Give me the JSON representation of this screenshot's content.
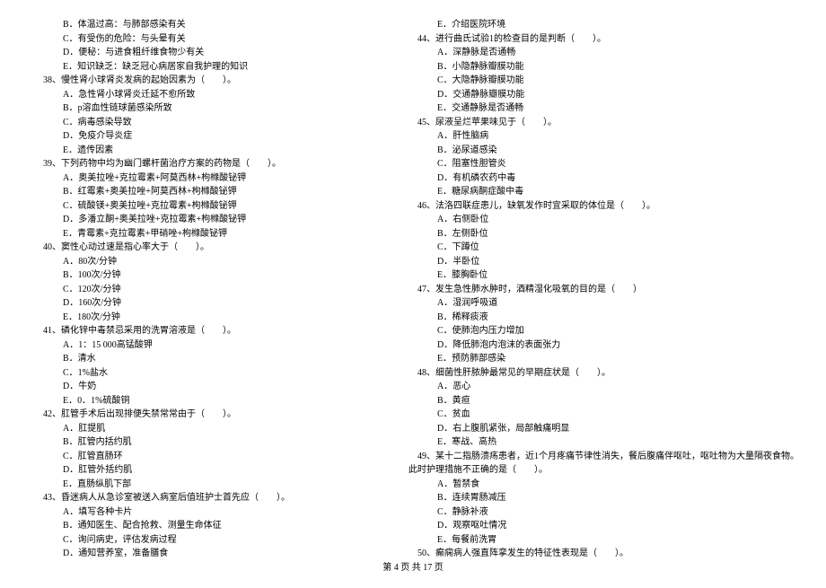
{
  "left_column": {
    "q37_options": [
      "B．体温过高：与肺部感染有关",
      "C．有受伤的危险：与头晕有关",
      "D．便秘：与进食粗纤维食物少有关",
      "E．知识缺乏：缺乏冠心病居家自我护理的知识"
    ],
    "q38": {
      "stem": "38、慢性肾小球肾炎发病的起始因素为（　　）。",
      "options": [
        "A．急性肾小球肾炎迁延不愈所致",
        "B．p溶血性链球菌感染所致",
        "C．病毒感染导致",
        "D．免疫介导炎症",
        "E．遗传因素"
      ]
    },
    "q39": {
      "stem": "39、下列药物中均为幽门螺杆菌治疗方案的药物是（　　）。",
      "options": [
        "A．奥美拉唑+克拉霉素+阿莫西林+枸橼酸铋钾",
        "B．红霉素+奥美拉唑+阿莫西林+枸橼酸铋钾",
        "C．硫酸镁+奥美拉唑+克拉霉素+枸橼酸铋钾",
        "D．多潘立酮+奥美拉唑+克拉霉素+枸橼酸铋钾",
        "E．青霉素+克拉霉素+甲硝唑+枸橼酸铋钾"
      ]
    },
    "q40": {
      "stem": "40、窦性心动过速是指心率大于（　　）。",
      "options": [
        "A．80次/分钟",
        "B．100次/分钟",
        "C．120次/分钟",
        "D．160次/分钟",
        "E．180次/分钟"
      ]
    },
    "q41": {
      "stem": "41、磷化锌中毒禁忌采用的洗胃溶液是（　　）。",
      "options": [
        "A．1：15 000高锰酸钾",
        "B．清水",
        "C．1%盐水",
        "D．牛奶",
        "E．0．1%硫酸铜"
      ]
    },
    "q42": {
      "stem": "42、肛管手术后出现排便失禁常常由于（　　）。",
      "options": [
        "A．肛提肌",
        "B．肛管内括约肌",
        "C．肛管直肠环",
        "D．肛管外括约肌",
        "E．直肠纵肌下部"
      ]
    },
    "q43": {
      "stem": "43、昏迷病人从急诊室被送入病室后值班护士首先应（　　）。",
      "options": [
        "A．填写各种卡片",
        "B．通知医生、配合抢救、测量生命体征",
        "C．询问病史，评估发病过程",
        "D．通知营养室，准备膳食"
      ]
    }
  },
  "right_column": {
    "q43_cont": [
      "E．介绍医院环境"
    ],
    "q44": {
      "stem": "44、进行曲氏试验1的检查目的是判断（　　）。",
      "options": [
        "A．深静脉是否通畅",
        "B．小隐静脉瓣膜功能",
        "C．大隐静脉瓣膜功能",
        "D．交通静脉瓣膜功能",
        "E．交通静脉是否通畅"
      ]
    },
    "q45": {
      "stem": "45、尿液呈烂苹果味见于（　　）。",
      "options": [
        "A．肝性脑病",
        "B．泌尿道感染",
        "C．阻塞性胆管炎",
        "D．有机磷农药中毒",
        "E．糖尿病酮症酸中毒"
      ]
    },
    "q46": {
      "stem": "46、法洛四联症患儿，缺氧发作时宜采取的体位是（　　）。",
      "options": [
        "A．右侧卧位",
        "B．左侧卧位",
        "C．下蹲位",
        "D．半卧位",
        "E．膝胸卧位"
      ]
    },
    "q47": {
      "stem": "47、发生急性肺水肿时，酒精湿化吸氧的目的是（　　）",
      "options": [
        "A．湿润呼吸道",
        "B．稀释痰液",
        "C．使肺泡内压力增加",
        "D．降低肺泡内泡沫的表面张力",
        "E．预防肺部感染"
      ]
    },
    "q48": {
      "stem": "48、细菌性肝脓肿最常见的早期症状是（　　）。",
      "options": [
        "A．恶心",
        "B．黄疸",
        "C．贫血",
        "D．右上腹肌紧张，局部触痛明显",
        "E．寒战、高热"
      ]
    },
    "q49": {
      "stem_l1": "49、某十二指肠溃疡患者，近1个月疼痛节律性消失，餐后腹痛伴呕吐，呕吐物为大量隔夜食物。",
      "stem_l2": "此时护理措施不正确的是（　　）。",
      "options": [
        "A．暂禁食",
        "B．连续胃肠减压",
        "C．静脉补液",
        "D．观察呕吐情况",
        "E．每餐前洗胃"
      ]
    },
    "q50": {
      "stem": "50、癫痫病人强直阵挛发生的特征性表现是（　　）。"
    }
  },
  "footer": "第 4 页 共 17 页"
}
